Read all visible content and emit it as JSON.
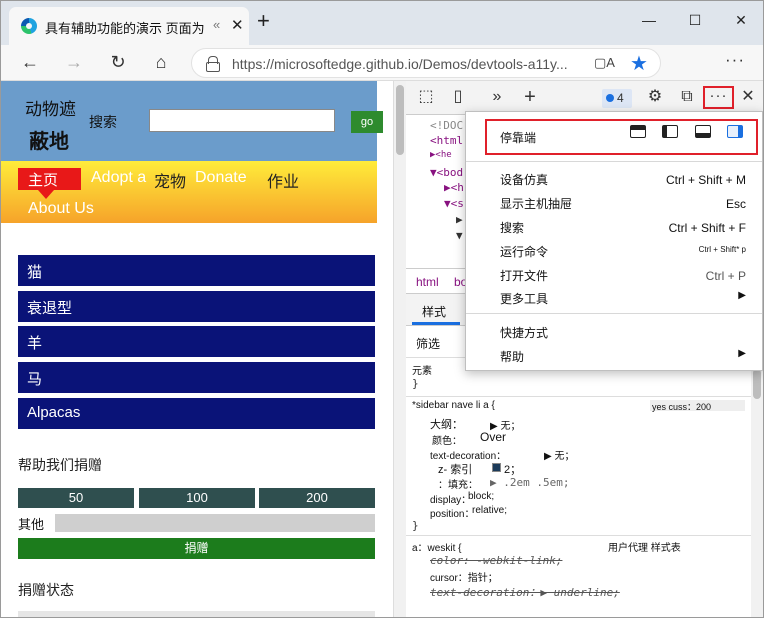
{
  "browser": {
    "tab_title": "具有辅助功能的演示 页面为",
    "tab_sep": "«",
    "url": "https://microsoftedge.github.io/Demos/devtools-a11y..."
  },
  "page": {
    "brand_line1": "动物遮",
    "brand_line2": "蔽地",
    "search_label": "搜索",
    "search_value": "",
    "go_label": "go",
    "nav": [
      "主页",
      "Adopt a",
      "宠物",
      "Donate",
      "作业",
      "About Us"
    ],
    "animals": [
      "猫",
      "衰退型",
      "羊",
      "马",
      "Alpacas"
    ],
    "donate_heading": "帮助我们捐赠",
    "amounts": [
      "50",
      "100",
      "200"
    ],
    "other_label": "其他",
    "donate_button": "捐赠",
    "donation_status": "捐赠状态"
  },
  "devtools": {
    "badge_count": "4",
    "dom_lines": [
      "<!DOC",
      "<html",
      "<he",
      "<bod",
      "<h",
      "<s",
      "",
      ""
    ],
    "breadcrumb": [
      "html",
      "bo"
    ],
    "tabs": [
      "样式"
    ],
    "filter_label": "筛选",
    "element_label": "元素",
    "styles": {
      "rule1_selector": "*sidebar nave li a {",
      "rule1_source": "yes cuss：200",
      "decls": [
        {
          "prop": "大纲：",
          "val": "无；"
        },
        {
          "prop": "颜色：",
          "val": "Over"
        },
        {
          "prop": "text-decoration：",
          "val": "无；"
        },
        {
          "prop": "z- 索引",
          "val": "2；"
        },
        {
          "prop": "：填充：",
          "val": ".2em .5em;"
        },
        {
          "prop": "display：",
          "val": "block;"
        },
        {
          "prop": "position：",
          "val": "relative;"
        }
      ],
      "rule2_selector": "a：weskit {",
      "rule2_source": "用户代理 样式表",
      "decls2": [
        {
          "text": "color: -webkit-link;"
        },
        {
          "text": "cursor：指针；"
        },
        {
          "text": "text-decoration：▶ underline;"
        }
      ]
    }
  },
  "menu": {
    "dock_label": "停靠端",
    "items": [
      {
        "label": "设备仿真",
        "shortcut": "Ctrl + Shift + M"
      },
      {
        "label": "显示主机抽屉",
        "shortcut": "Esc"
      },
      {
        "label": "搜索",
        "shortcut": "Ctrl + Shift + F"
      },
      {
        "label": "运行命令",
        "shortcut": "Ctrl + Shift* p"
      },
      {
        "label": "打开文件",
        "shortcut": "Ctrl + P"
      },
      {
        "label": "更多工具",
        "shortcut": "▶"
      },
      {
        "label": "快捷方式",
        "shortcut": ""
      },
      {
        "label": "帮助",
        "shortcut": "▶"
      }
    ]
  },
  "colors": {
    "accent_red": "#e0202a",
    "header_blue": "#6b9ccb",
    "animal_navy": "#0a1378",
    "go_green": "#2e8b2e"
  }
}
